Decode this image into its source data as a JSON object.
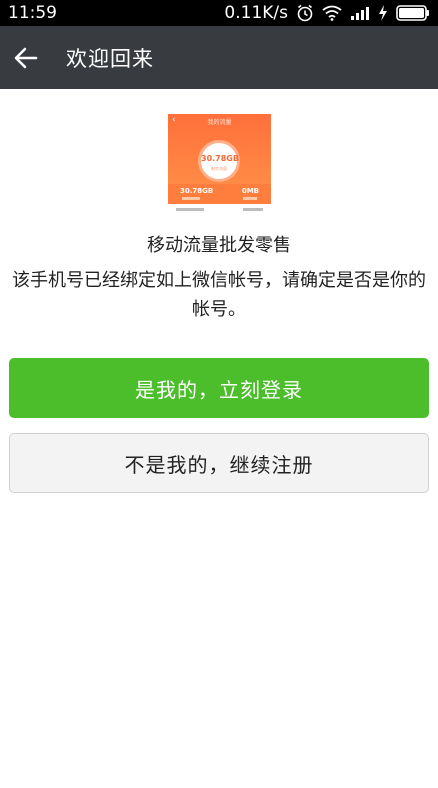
{
  "status_bar": {
    "time": "11:59",
    "network_speed": "0.11K/s",
    "icons": [
      "alarm-icon",
      "wifi-icon",
      "signal-icon",
      "charging-icon",
      "battery-icon"
    ]
  },
  "app_bar": {
    "back_icon": "back-arrow-icon",
    "title": "欢迎回来"
  },
  "account_preview": {
    "header": "我的流量",
    "total": "30.78GB",
    "total_caption": "剩余流量",
    "left_value": "30.78GB",
    "right_value": "0MB"
  },
  "account": {
    "app_name": "移动流量批发零售",
    "description": "该手机号已经绑定如上微信帐号，请确定是否是你的帐号。"
  },
  "actions": {
    "confirm_label": "是我的，立刻登录",
    "register_label": "不是我的，继续注册"
  },
  "colors": {
    "status_bar": "#000000",
    "app_bar": "#383b3f",
    "primary_button": "#4cbe2c",
    "secondary_button": "#f3f3f3"
  }
}
